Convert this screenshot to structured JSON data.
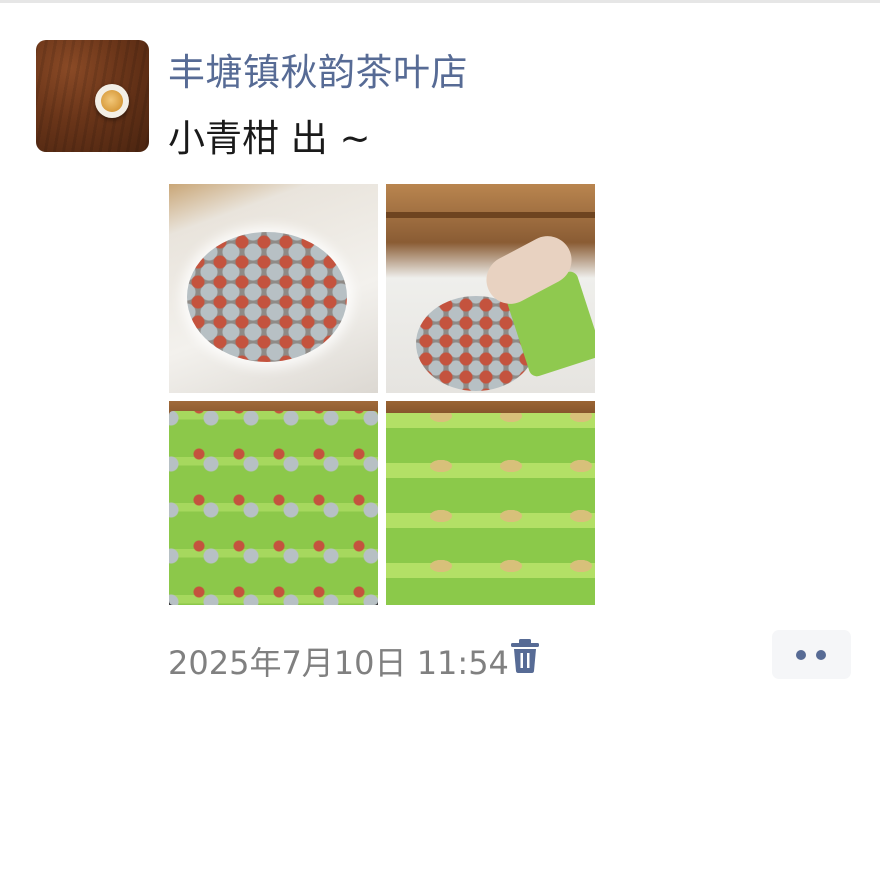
{
  "post": {
    "author": "丰塘镇秋韵茶叶店",
    "text": "小青柑 出 ~",
    "timestamp": "2025年7月10日 11:54"
  },
  "photos": [
    {
      "subject": "sack-of-citrus-tea"
    },
    {
      "subject": "hands-packing-bags"
    },
    {
      "subject": "standing-green-bags"
    },
    {
      "subject": "lying-green-bags"
    }
  ],
  "colors": {
    "author_name": "#576b95",
    "post_text": "#1a1a1a",
    "timestamp": "#808080",
    "more_button_bg": "#f5f6f8"
  },
  "icons": {
    "delete": "trash-icon",
    "more": "more-dots-icon"
  }
}
